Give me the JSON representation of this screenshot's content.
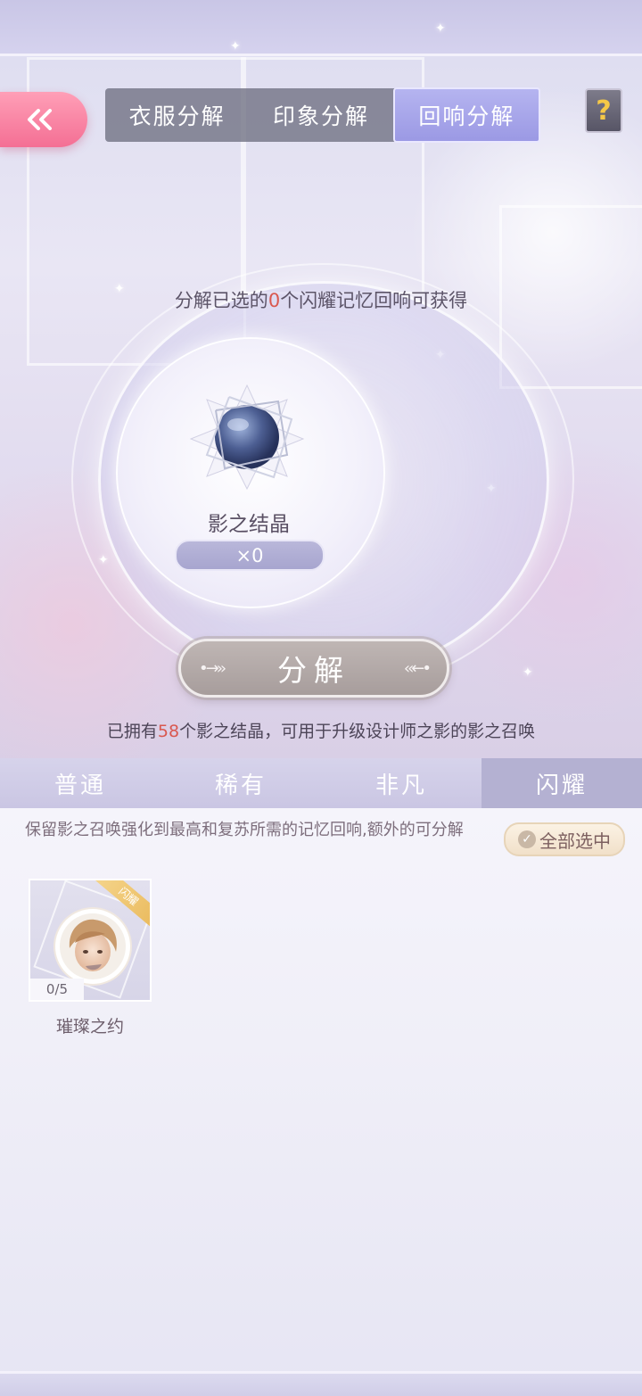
{
  "nav": {
    "tabs": [
      {
        "label": "衣服分解"
      },
      {
        "label": "印象分解"
      },
      {
        "label": "回响分解"
      }
    ],
    "active_tab": "回响分解",
    "help_label": "?"
  },
  "summary": {
    "prefix": "分解已选的",
    "selected_count": "0",
    "suffix": "个闪耀记忆回响可获得",
    "reward_name": "影之结晶",
    "reward_count": "×0"
  },
  "decompose_button": {
    "label": "分解"
  },
  "owned": {
    "prefix": "已拥有",
    "count": "58",
    "suffix": "个影之结晶，可用于升级设计师之影的影之召唤"
  },
  "rarity_tabs": [
    {
      "label": "普通"
    },
    {
      "label": "稀有"
    },
    {
      "label": "非凡"
    },
    {
      "label": "闪耀"
    }
  ],
  "active_rarity": "闪耀",
  "list": {
    "hint": "保留影之召唤强化到最高和复苏所需的记忆回响,额外的可分解",
    "select_all_label": "全部选中",
    "items": [
      {
        "name": "璀璨之约",
        "rarity_badge": "闪耀",
        "progress": "0/5"
      }
    ]
  },
  "colors": {
    "accent_pink": "#f46f94",
    "active_tab": "#9b99e4",
    "highlight_red": "#d9584f"
  },
  "icons": {
    "back": "double-chevron-left-icon",
    "help": "question-mark-icon",
    "reward": "crystal-icon",
    "check": "check-circle-icon"
  }
}
